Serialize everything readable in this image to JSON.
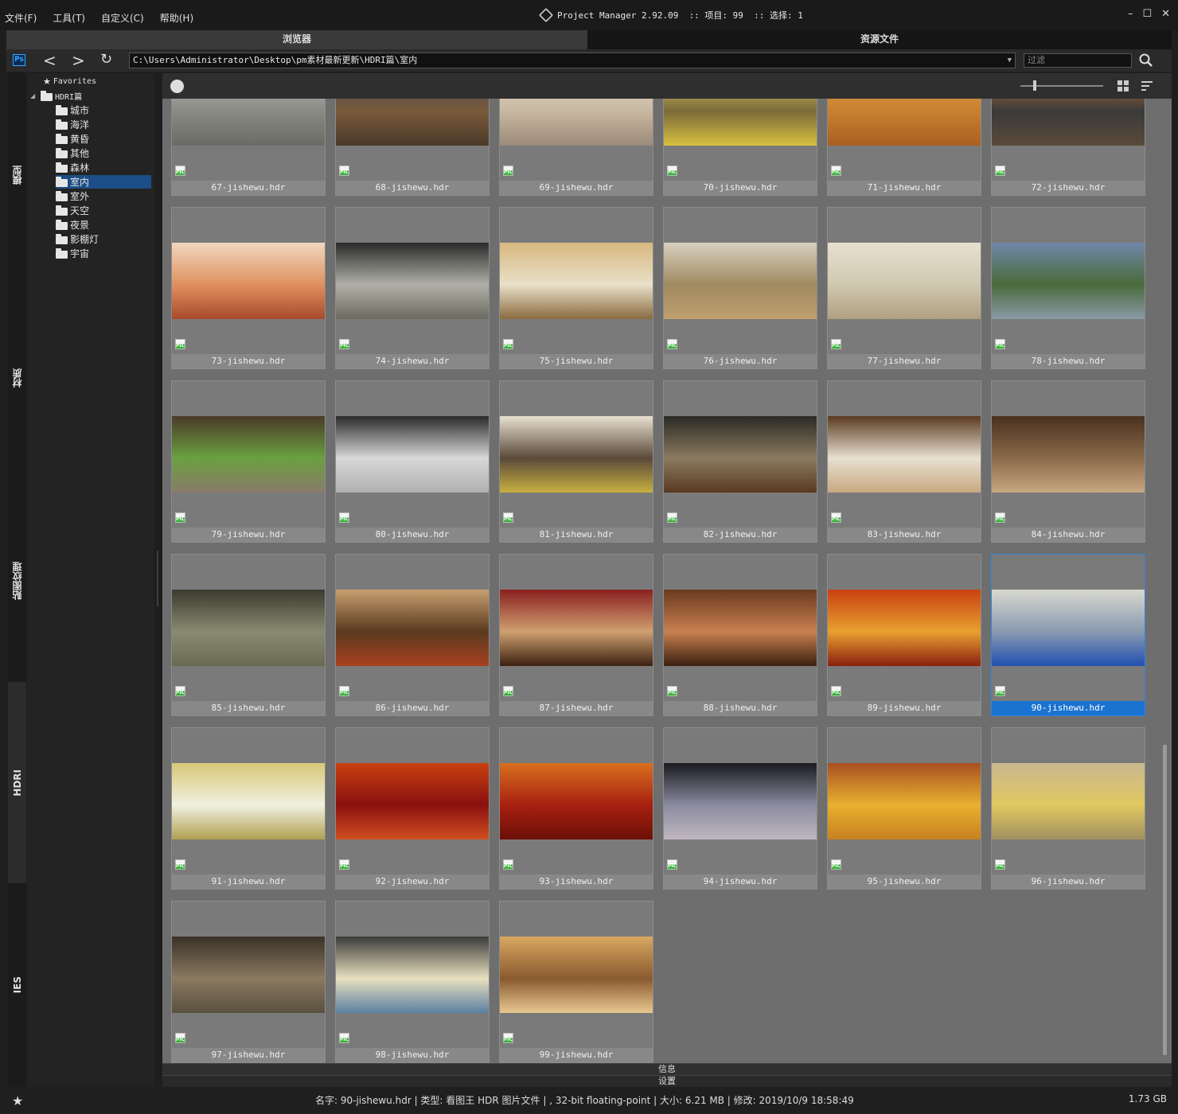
{
  "menu": [
    "文件(F)",
    "工具(T)",
    "自定义(C)",
    "帮助(H)"
  ],
  "window": {
    "title": "Project Manager 2.92.09  :: 项目: 99  :: 选择: 1",
    "controls": [
      "–",
      "☐",
      "✕"
    ]
  },
  "tabs": {
    "browser": "浏览器",
    "assets": "资源文件"
  },
  "address": {
    "path": "C:\\Users\\Administrator\\Desktop\\pm素材最新更新\\HDRI篇\\室内",
    "filter_placeholder": "过滤"
  },
  "side_tabs": [
    "模型",
    "材质",
    "贴图纹理",
    "HDRI",
    "IES"
  ],
  "tree": {
    "favorites": "Favorites",
    "root": "HDRI篇",
    "children": [
      "城市",
      "海洋",
      "黄昏",
      "其他",
      "森林",
      "室内",
      "室外",
      "天空",
      "夜景",
      "影棚灯",
      "宇宙"
    ],
    "selected": "室内"
  },
  "items": [
    {
      "label": "67-jishewu.hdr",
      "colors": [
        "#bfbfb8",
        "#8a8a84",
        "#6b6b66"
      ]
    },
    {
      "label": "68-jishewu.hdr",
      "colors": [
        "#3c4a6a",
        "#7a5a3a",
        "#4a3a2a"
      ]
    },
    {
      "label": "69-jishewu.hdr",
      "colors": [
        "#e0d8cc",
        "#c8b8a0",
        "#9a8a78"
      ]
    },
    {
      "label": "70-jishewu.hdr",
      "colors": [
        "#e8d46a",
        "#7a6a3a",
        "#d8c040"
      ]
    },
    {
      "label": "71-jishewu.hdr",
      "colors": [
        "#e0a040",
        "#c88030",
        "#a86020"
      ]
    },
    {
      "label": "72-jishewu.hdr",
      "colors": [
        "#c87830",
        "#3a3a3a",
        "#5a4a3a"
      ]
    },
    {
      "label": "73-jishewu.hdr",
      "colors": [
        "#f0d8c0",
        "#e09060",
        "#a84a2a"
      ]
    },
    {
      "label": "74-jishewu.hdr",
      "colors": [
        "#2a2a2a",
        "#b0b0a8",
        "#6a6a60"
      ]
    },
    {
      "label": "75-jishewu.hdr",
      "colors": [
        "#d8b880",
        "#e8e0c8",
        "#8a6a40"
      ]
    },
    {
      "label": "76-jishewu.hdr",
      "colors": [
        "#d8d0c0",
        "#a08a60",
        "#c0a070"
      ]
    },
    {
      "label": "77-jishewu.hdr",
      "colors": [
        "#e8e0d0",
        "#d0c8b0",
        "#b0a080"
      ]
    },
    {
      "label": "78-jishewu.hdr",
      "colors": [
        "#7088a8",
        "#4a6a3a",
        "#8a9aa8"
      ]
    },
    {
      "label": "79-jishewu.hdr",
      "colors": [
        "#4a3a2a",
        "#6aa040",
        "#8a7a6a"
      ]
    },
    {
      "label": "80-jishewu.hdr",
      "colors": [
        "#2a2a2a",
        "#d8d8d8",
        "#b0b0b0"
      ]
    },
    {
      "label": "81-jishewu.hdr",
      "colors": [
        "#e8e0d0",
        "#5a4a3a",
        "#c8b040"
      ]
    },
    {
      "label": "82-jishewu.hdr",
      "colors": [
        "#2a2a24",
        "#8a7a60",
        "#5a3a20"
      ]
    },
    {
      "label": "83-jishewu.hdr",
      "colors": [
        "#5a3a20",
        "#e8e0d0",
        "#c8a880"
      ]
    },
    {
      "label": "84-jishewu.hdr",
      "colors": [
        "#4a3020",
        "#8a6a4a",
        "#c8a880"
      ]
    },
    {
      "label": "85-jishewu.hdr",
      "colors": [
        "#3a3a30",
        "#8a8a70",
        "#6a6a50"
      ]
    },
    {
      "label": "86-jishewu.hdr",
      "colors": [
        "#c8a070",
        "#5a3a20",
        "#a84020"
      ]
    },
    {
      "label": "87-jishewu.hdr",
      "colors": [
        "#8a2020",
        "#d0a070",
        "#3a2010"
      ]
    },
    {
      "label": "88-jishewu.hdr",
      "colors": [
        "#6a3a20",
        "#c88050",
        "#3a2010"
      ]
    },
    {
      "label": "89-jishewu.hdr",
      "colors": [
        "#c84010",
        "#e8a030",
        "#8a2010"
      ]
    },
    {
      "label": "90-jishewu.hdr",
      "colors": [
        "#d8d8d0",
        "#8a9ab0",
        "#2050b0"
      ]
    },
    {
      "label": "91-jishewu.hdr",
      "colors": [
        "#d8c878",
        "#f0f0e0",
        "#b0a050"
      ]
    },
    {
      "label": "92-jishewu.hdr",
      "colors": [
        "#c84010",
        "#8a1010",
        "#d05020"
      ]
    },
    {
      "label": "93-jishewu.hdr",
      "colors": [
        "#d87020",
        "#a82010",
        "#6a1008"
      ]
    },
    {
      "label": "94-jishewu.hdr",
      "colors": [
        "#1a1a20",
        "#8a8aa0",
        "#c0b8c0"
      ]
    },
    {
      "label": "95-jishewu.hdr",
      "colors": [
        "#a85020",
        "#e8b030",
        "#c88020"
      ]
    },
    {
      "label": "96-jishewu.hdr",
      "colors": [
        "#c8b890",
        "#e0c860",
        "#a09060"
      ]
    },
    {
      "label": "97-jishewu.hdr",
      "colors": [
        "#3a3028",
        "#8a7a60",
        "#5a5040"
      ]
    },
    {
      "label": "98-jishewu.hdr",
      "colors": [
        "#3a3a3a",
        "#e8e0c0",
        "#5a80a0"
      ]
    },
    {
      "label": "99-jishewu.hdr",
      "colors": [
        "#d8a860",
        "#8a5a30",
        "#e8c890"
      ]
    }
  ],
  "selected_item": "90-jishewu.hdr",
  "panels": {
    "info": "信息",
    "settings": "设置"
  },
  "status": {
    "details": "名字: 90-jishewu.hdr | 类型: 看图王 HDR 图片文件 | , 32-bit floating-point | 大小: 6.21 MB | 修改: 2019/10/9 18:58:49",
    "disk_free": "1.73 GB"
  },
  "colors": {
    "accent": "#1a73d0",
    "grid_bg": "#6e6e6e",
    "tree_selected": "#1d4d86"
  }
}
